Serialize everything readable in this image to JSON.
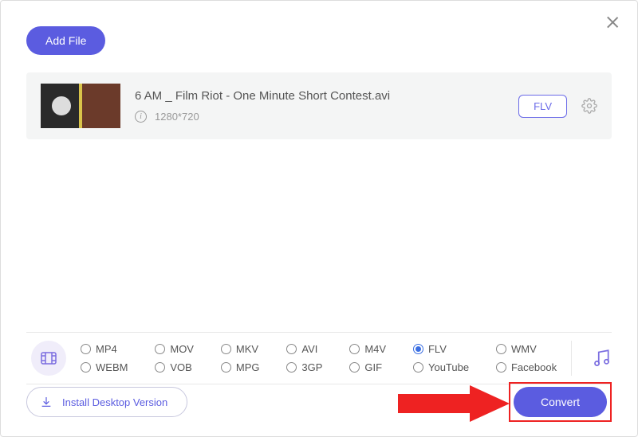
{
  "buttons": {
    "add_file": "Add File",
    "install_desktop": "Install Desktop Version",
    "convert": "Convert"
  },
  "file": {
    "title": "6 AM _ Film Riot - One Minute Short Contest.avi",
    "resolution": "1280*720",
    "selected_format": "FLV"
  },
  "formats": {
    "row1": [
      "MP4",
      "MOV",
      "MKV",
      "AVI",
      "M4V",
      "FLV",
      "WMV"
    ],
    "row2": [
      "WEBM",
      "VOB",
      "MPG",
      "3GP",
      "GIF",
      "YouTube",
      "Facebook"
    ],
    "selected": "FLV"
  },
  "icons": {
    "info_char": "i"
  }
}
